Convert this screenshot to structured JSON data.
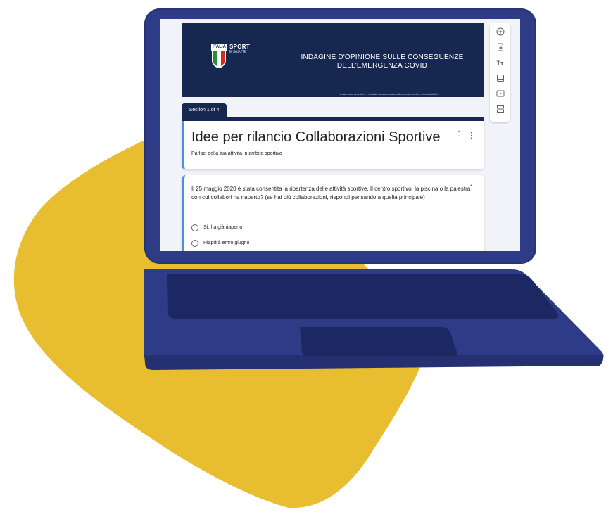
{
  "colors": {
    "blob": "#e8bd2f",
    "laptop": "#2e3b86",
    "laptop_dark": "#243072",
    "banner": "#16284f",
    "accent": "#4a90e2",
    "required": "#d93025"
  },
  "banner": {
    "logo_box": "ITALIA",
    "logo_title": "SPORT",
    "logo_subtitle": "E SALUTE",
    "title_line1": "INDAGINE D'OPINIONE SULLE CONSEGUENZE",
    "title_line2": "DELL'EMERGENZA COVID",
    "note": "I dati sono anonimi e i risultati saranno elaborati esclusivamente a fini statistici."
  },
  "section": {
    "label": "Section 1 of 4"
  },
  "title_card": {
    "title": "Idee per rilancio Collaborazioni Sportive",
    "description": "Parlaci della tua attività in ambito sportivo",
    "collapse_icon": "collapse-icon",
    "more_icon": "more-vert-icon"
  },
  "question": {
    "text": "Il 25 maggio 2020 è stata consentita la ripartenza delle attività sportive. Il centro sportivo, la piscina o la palestra con cui collabori ha riaperto? (se hai più collaborazioni, rispondi pensando a quella principale)",
    "required_mark": "*",
    "options": [
      "Sì, ha già riaperto",
      "Riaprirà entro giugno"
    ]
  },
  "toolbar": {
    "icons": [
      "add-question-icon",
      "import-questions-icon",
      "add-title-icon",
      "add-image-icon",
      "add-video-icon",
      "add-section-icon"
    ]
  }
}
